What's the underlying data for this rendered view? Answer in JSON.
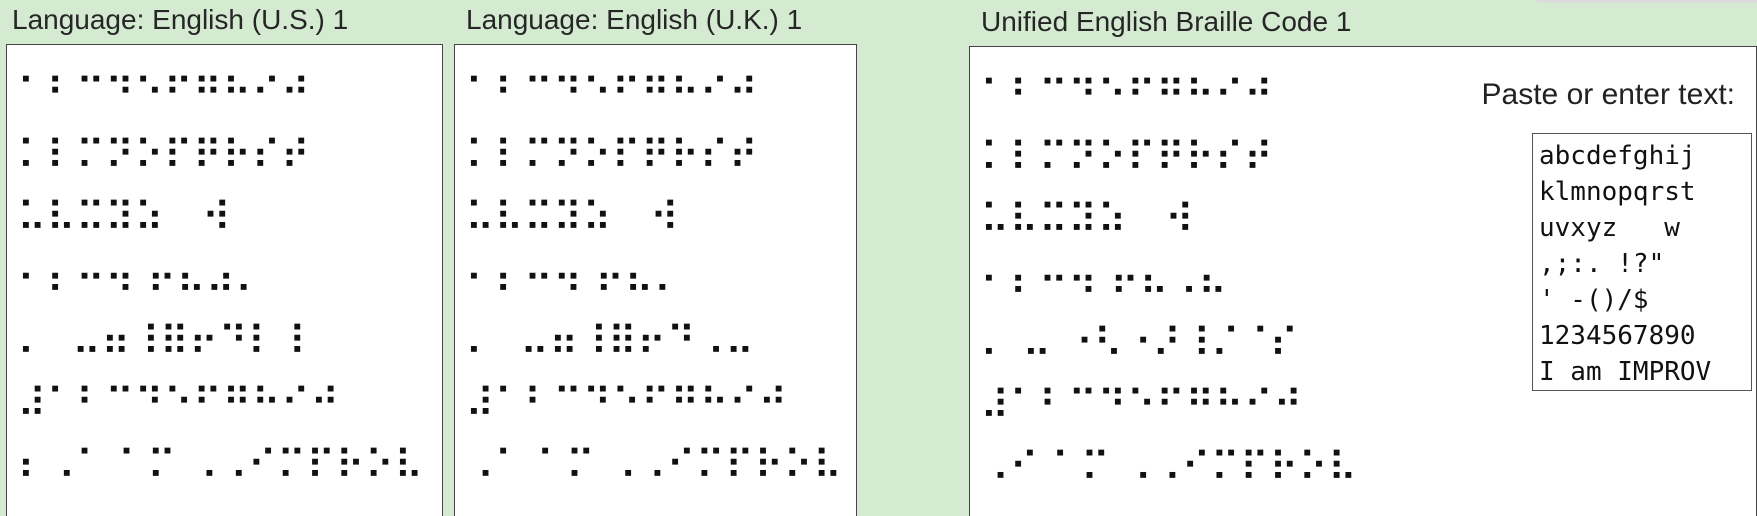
{
  "panes": [
    {
      "title": "Language: English (U.S.) 1",
      "lines": [
        "⠁⠃⠉⠙⠑⠋⠛⠓⠊⠚",
        "⠅⠇⠍⠝⠕⠏⠟⠗⠎⠞",
        "⠥⠧⠭⠽⠵   ⠺",
        "⠂⠆⠒⠲ ⠖⠦⠴⠄",
        "⠄  ⠤⠶⠸⠿⠖⠙⠇⠸",
        "⠼⠁⠃⠉⠙⠑⠋⠛⠓⠊⠚",
        "⠆⠠⠁ ⠁⠍ ⠠⠠⠊⠍⠏⠗⠕⠧"
      ]
    },
    {
      "title": "Language: English (U.K.) 1",
      "lines": [
        "⠁⠃⠉⠙⠑⠋⠛⠓⠊⠚",
        "⠅⠇⠍⠝⠕⠏⠟⠗⠎⠞",
        "⠥⠧⠭⠽⠵   ⠺",
        "⠂⠆⠒⠲ ⠖⠦⠄",
        "⠄  ⠤⠶⠸⠿⠖⠙⠠⠤",
        "⠼⠁⠃⠉⠙⠑⠋⠛⠓⠊⠚",
        "⠠⠁ ⠁⠍ ⠠⠠⠊⠍⠏⠗⠕⠧"
      ]
    },
    {
      "title": "Unified English Braille Code 1",
      "lines": [
        "⠁⠃⠉⠙⠑⠋⠛⠓⠊⠚",
        "⠅⠇⠍⠝⠕⠏⠟⠗⠎⠞",
        "⠥⠧⠭⠽⠵   ⠺",
        "⠂⠆⠒⠲ ⠖⠦⠠⠦",
        "⠄ ⠤ ⠐⠣⠐⠜⠸⠌⠈⠎",
        "⠼⠁⠃⠉⠙⠑⠋⠛⠓⠊⠚",
        "⠠⠊ ⠁⠍ ⠠⠠⠊⠍⠏⠗⠕⠧"
      ]
    }
  ],
  "input": {
    "label": "Paste or enter text:",
    "value": "abcdefghij\nklmnopqrst\nuvxyz   w\n,;:. !?\"\n' -()/$\n1234567890\nI am IMPROV"
  }
}
